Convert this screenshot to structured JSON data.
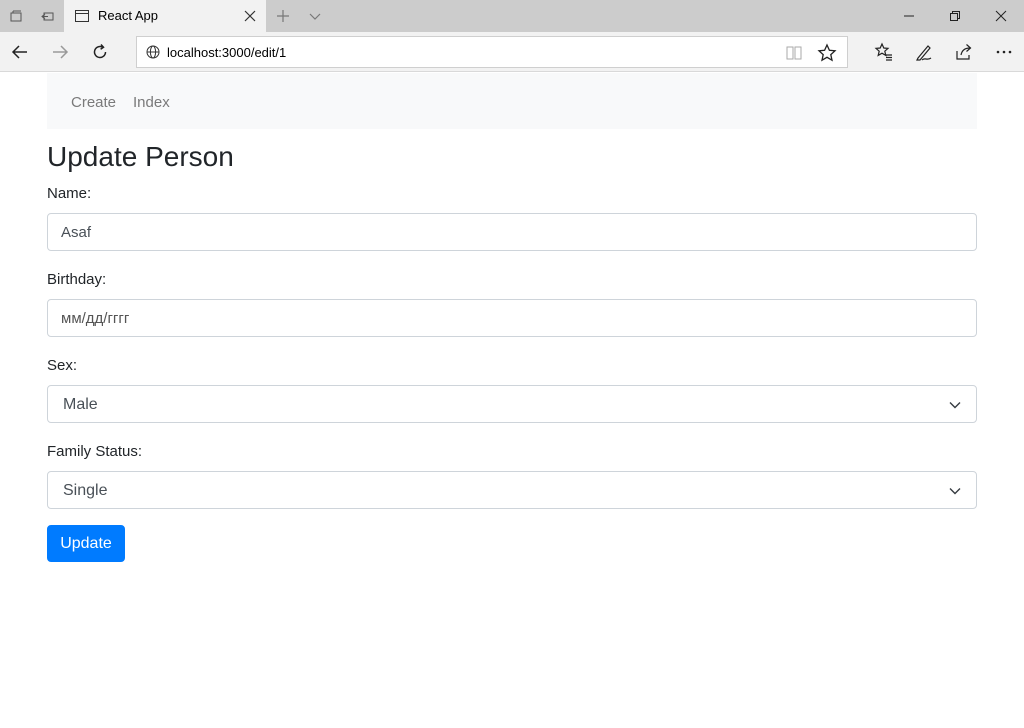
{
  "browser": {
    "tab": {
      "title": "React App"
    },
    "address": {
      "url": "localhost:3000/edit/1"
    }
  },
  "icons": {
    "tab_previews": "tabs-aside-icon",
    "tab_restore": "set-aside-tabs-icon",
    "favicon": "page-icon",
    "tab_close": "close-icon",
    "new_tab": "plus-icon",
    "tab_list": "chevron-down-icon",
    "minimize": "minimize-icon",
    "restore": "restore-icon",
    "window_close": "close-icon",
    "back": "back-arrow-icon",
    "forward": "forward-arrow-icon",
    "refresh": "refresh-icon",
    "site_info": "globe-icon",
    "reading_view": "reading-view-icon",
    "favorite": "star-icon",
    "favorites_hub": "favorites-list-icon",
    "notes": "pen-icon",
    "share": "share-icon",
    "more": "more-icon"
  },
  "nav": {
    "create": "Create",
    "index": "Index"
  },
  "form": {
    "title": "Update Person",
    "name_label": "Name:",
    "name_value": "Asaf",
    "birthday_label": "Birthday:",
    "birthday_placeholder": "мм/дд/гггг",
    "sex_label": "Sex:",
    "sex_value": "Male",
    "family_label": "Family Status:",
    "family_value": "Single",
    "submit_label": "Update"
  },
  "colors": {
    "primary": "#007bff",
    "nav_bg": "#f8f9fa",
    "border": "#ced4da"
  }
}
